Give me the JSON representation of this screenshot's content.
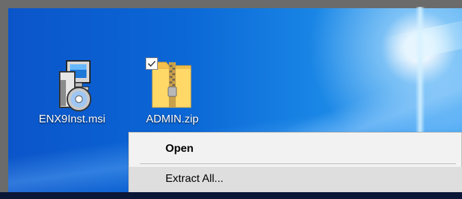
{
  "desktop": {
    "icons": [
      {
        "label": "ENX9Inst.msi"
      },
      {
        "label": "ADMIN.zip"
      }
    ]
  },
  "context_menu": {
    "items": [
      {
        "label": "Open"
      },
      {
        "label": "Extract All..."
      }
    ]
  }
}
